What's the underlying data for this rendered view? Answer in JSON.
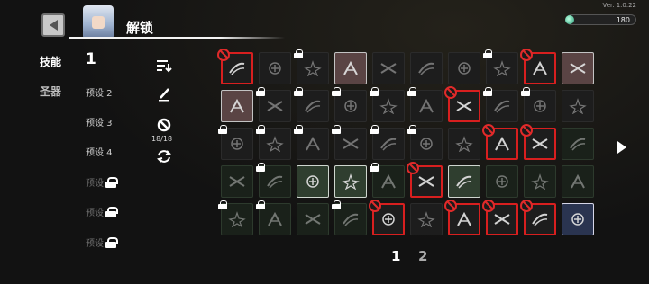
{
  "header": {
    "title": "解锁",
    "version": "Ver. 1.0.22",
    "currency": 180
  },
  "nav": {
    "skill_tab": "技能",
    "relic_tab": "圣器",
    "current_preset": "1",
    "presets": [
      {
        "label": "预设 2",
        "locked": false
      },
      {
        "label": "预设 3",
        "locked": false
      },
      {
        "label": "预设 4",
        "locked": false
      },
      {
        "label": "预设",
        "locked": true
      },
      {
        "label": "预设",
        "locked": true
      },
      {
        "label": "预设",
        "locked": true
      }
    ]
  },
  "tools": {
    "banned_count": "18/18"
  },
  "grid": {
    "rows": [
      [
        {
          "t": "banned"
        },
        {
          "t": "dim"
        },
        {
          "t": "lock"
        },
        {
          "t": "active"
        },
        {
          "t": "dim"
        },
        {
          "t": "dim"
        },
        {
          "t": "dim"
        },
        {
          "t": "lock"
        },
        {
          "t": "banned"
        },
        {
          "t": "active"
        }
      ],
      [
        {
          "t": "active"
        },
        {
          "t": "lock"
        },
        {
          "t": "lock"
        },
        {
          "t": "lock"
        },
        {
          "t": "lock"
        },
        {
          "t": "lock"
        },
        {
          "t": "banned"
        },
        {
          "t": "lock"
        },
        {
          "t": "lock"
        },
        {
          "t": "dim"
        }
      ],
      [
        {
          "t": "lock"
        },
        {
          "t": "lock"
        },
        {
          "t": "lock"
        },
        {
          "t": "lock"
        },
        {
          "t": "lock"
        },
        {
          "t": "lock"
        },
        {
          "t": "dim"
        },
        {
          "t": "banned"
        },
        {
          "t": "banned"
        },
        {
          "t": "green"
        }
      ],
      [
        {
          "t": "green"
        },
        {
          "t": "lock-green"
        },
        {
          "t": "active-green"
        },
        {
          "t": "active-green"
        },
        {
          "t": "lock-green"
        },
        {
          "t": "banned"
        },
        {
          "t": "active-green"
        },
        {
          "t": "green"
        },
        {
          "t": "green"
        },
        {
          "t": "green"
        }
      ],
      [
        {
          "t": "lock-green"
        },
        {
          "t": "lock-green"
        },
        {
          "t": "green"
        },
        {
          "t": "lock-green"
        },
        {
          "t": "banned"
        },
        {
          "t": "dim"
        },
        {
          "t": "banned"
        },
        {
          "t": "banned"
        },
        {
          "t": "banned"
        },
        {
          "t": "active-blue"
        }
      ]
    ]
  },
  "pagination": {
    "page1": "1",
    "page2": "2"
  },
  "icons": {
    "back": "back-arrow-icon",
    "sort": "sort-icon",
    "edit": "pen-icon",
    "ban": "ban-icon",
    "refresh": "refresh-icon",
    "next": "next-page-icon",
    "currency": "gem-icon"
  }
}
